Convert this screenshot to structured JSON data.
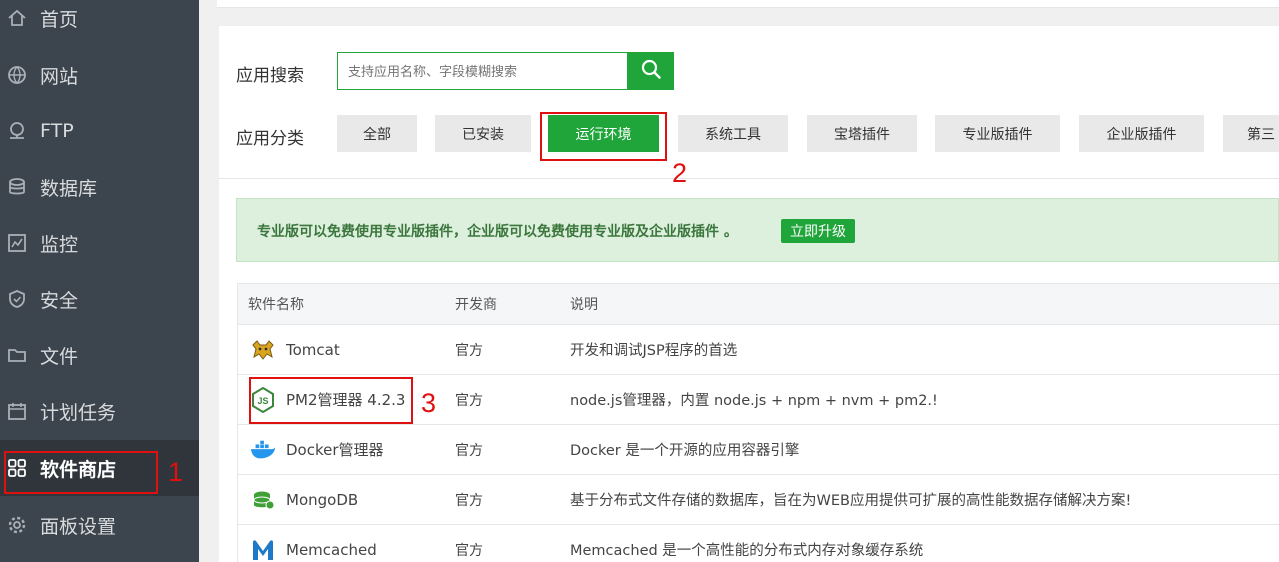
{
  "sidebar": {
    "items": [
      {
        "label": "首页",
        "icon": "home-icon"
      },
      {
        "label": "网站",
        "icon": "globe-icon"
      },
      {
        "label": "FTP",
        "icon": "ftp-icon"
      },
      {
        "label": "数据库",
        "icon": "database-icon"
      },
      {
        "label": "监控",
        "icon": "monitor-icon"
      },
      {
        "label": "安全",
        "icon": "shield-icon"
      },
      {
        "label": "文件",
        "icon": "folder-icon"
      },
      {
        "label": "计划任务",
        "icon": "calendar-icon"
      },
      {
        "label": "软件商店",
        "icon": "grid-icon",
        "active": true
      },
      {
        "label": "面板设置",
        "icon": "gear-icon"
      }
    ]
  },
  "search": {
    "label": "应用搜索",
    "placeholder": "支持应用名称、字段模糊搜索",
    "button_icon": "search-icon"
  },
  "categories": {
    "label": "应用分类",
    "items": [
      "全部",
      "已安装",
      "运行环境",
      "系统工具",
      "宝塔插件",
      "专业版插件",
      "企业版插件",
      "第三"
    ],
    "active": "运行环境"
  },
  "promo": {
    "text": "专业版可以免费使用专业版插件，企业版可以免费使用专业版及企业版插件 。",
    "button": "立即升级"
  },
  "table": {
    "headers": {
      "name": "软件名称",
      "developer": "开发商",
      "description": "说明"
    },
    "rows": [
      {
        "name": "Tomcat",
        "developer": "官方",
        "description": "开发和调试JSP程序的首选",
        "icon": "tomcat-icon"
      },
      {
        "name": "PM2管理器 4.2.3",
        "developer": "官方",
        "description": "node.js管理器，内置 node.js + npm + nvm + pm2.!",
        "icon": "nodejs-icon"
      },
      {
        "name": "Docker管理器",
        "developer": "官方",
        "description": "Docker 是一个开源的应用容器引擎",
        "icon": "docker-icon"
      },
      {
        "name": "MongoDB",
        "developer": "官方",
        "description": "基于分布式文件存储的数据库，旨在为WEB应用提供可扩展的高性能数据存储解决方案!",
        "icon": "mongodb-icon"
      },
      {
        "name": "Memcached",
        "developer": "官方",
        "description": "Memcached 是一个高性能的分布式内存对象缓存系统",
        "icon": "memcached-icon"
      }
    ]
  },
  "annotations": [
    "1",
    "2",
    "3"
  ],
  "colors": {
    "accent": "#20a53a",
    "sidebar": "#3c444d",
    "annotation": "#e01010"
  }
}
